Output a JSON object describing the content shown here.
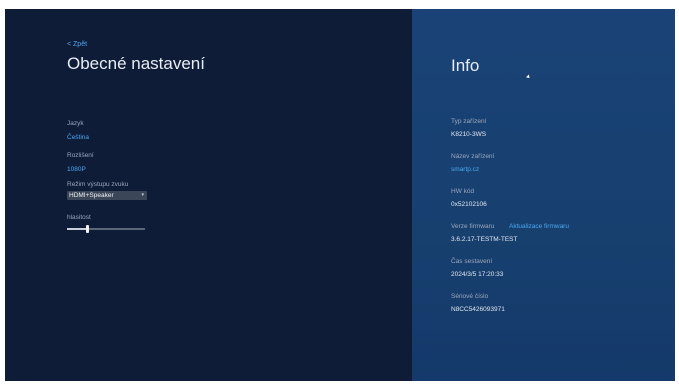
{
  "left": {
    "back_label": "< Zpět",
    "title": "Obecné nastavení",
    "language": {
      "label": "Jazyk",
      "value": "Čeština"
    },
    "resolution": {
      "label": "Rozlišení",
      "value": "1080P"
    },
    "audio_output": {
      "label": "Režim výstupu zvuku",
      "value": "HDMI+Speaker"
    },
    "volume": {
      "label": "hlasitost",
      "level": 0.25
    }
  },
  "right": {
    "title": "Info",
    "device_type": {
      "label": "Typ zařízení",
      "value": "K8210-3WS"
    },
    "device_name": {
      "label": "Název zařízení",
      "value": "smartp.cz"
    },
    "hw_code": {
      "label": "HW kód",
      "value": "0x52102106"
    },
    "firmware": {
      "label": "Verze firmwaru",
      "update_link": "Aktualizace firmwaru",
      "value": "3.6.2.17-TESTM-TEST"
    },
    "build_time": {
      "label": "Čas sestavení",
      "value": "2024/3/5 17:20:33"
    },
    "serial": {
      "label": "Sériové číslo",
      "value": "N8CC5426093971"
    }
  },
  "colors": {
    "left_bg": "#0f1c38",
    "right_bg": "#1a4277",
    "accent": "#4aa8f2"
  }
}
